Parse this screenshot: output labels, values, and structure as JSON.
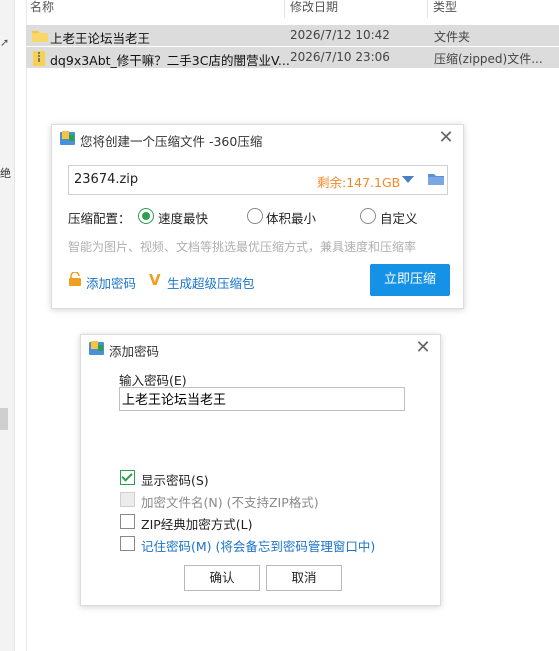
{
  "explorer": {
    "columns": {
      "name": "名称",
      "date": "修改日期",
      "type": "类型"
    },
    "rows": [
      {
        "name": "上老王论坛当老王",
        "date": "2026/7/12 10:42",
        "type": "文件夹"
      },
      {
        "name": "dq9x3Abt_修干嘛？二手3C店的闇营业V...",
        "date": "2026/7/10 23:06",
        "type": "压缩(zipped)文件..."
      }
    ],
    "nav_fragment": "绝"
  },
  "compress_dialog": {
    "title": "您将创建一个压缩文件 -360压缩",
    "filename": "23674.zip",
    "free_space": "剩余:147.1GB",
    "mode_label": "压缩配置：",
    "options": [
      "速度最快",
      "体积最小",
      "自定义"
    ],
    "selected_option": "速度最快",
    "hint": "智能为图片、视频、文档等挑选最优压缩方式，兼具速度和压缩率",
    "add_password": "添加密码",
    "super_pack": "生成超级压缩包",
    "start_button": "立即压缩"
  },
  "password_dialog": {
    "title": "添加密码",
    "input_label": "输入密码(E)",
    "password_value": "上老王论坛当老王",
    "checkboxes": [
      {
        "label": "显示密码(S)",
        "checked": true,
        "disabled": false
      },
      {
        "label": "加密文件名(N) (不支持ZIP格式)",
        "checked": false,
        "disabled": true
      },
      {
        "label": "ZIP经典加密方式(L)",
        "checked": false,
        "disabled": false
      },
      {
        "label": "记住密码(M) (将会备忘到密码管理窗口中)",
        "checked": false,
        "disabled": false
      }
    ],
    "ok_button": "确认",
    "cancel_button": "取消"
  },
  "colors": {
    "accent_blue": "#1592e6",
    "link_blue": "#1a73c8",
    "free_orange": "#f08a24",
    "radio_green": "#2e9e4f",
    "row_selected": "#dcdcdc"
  }
}
